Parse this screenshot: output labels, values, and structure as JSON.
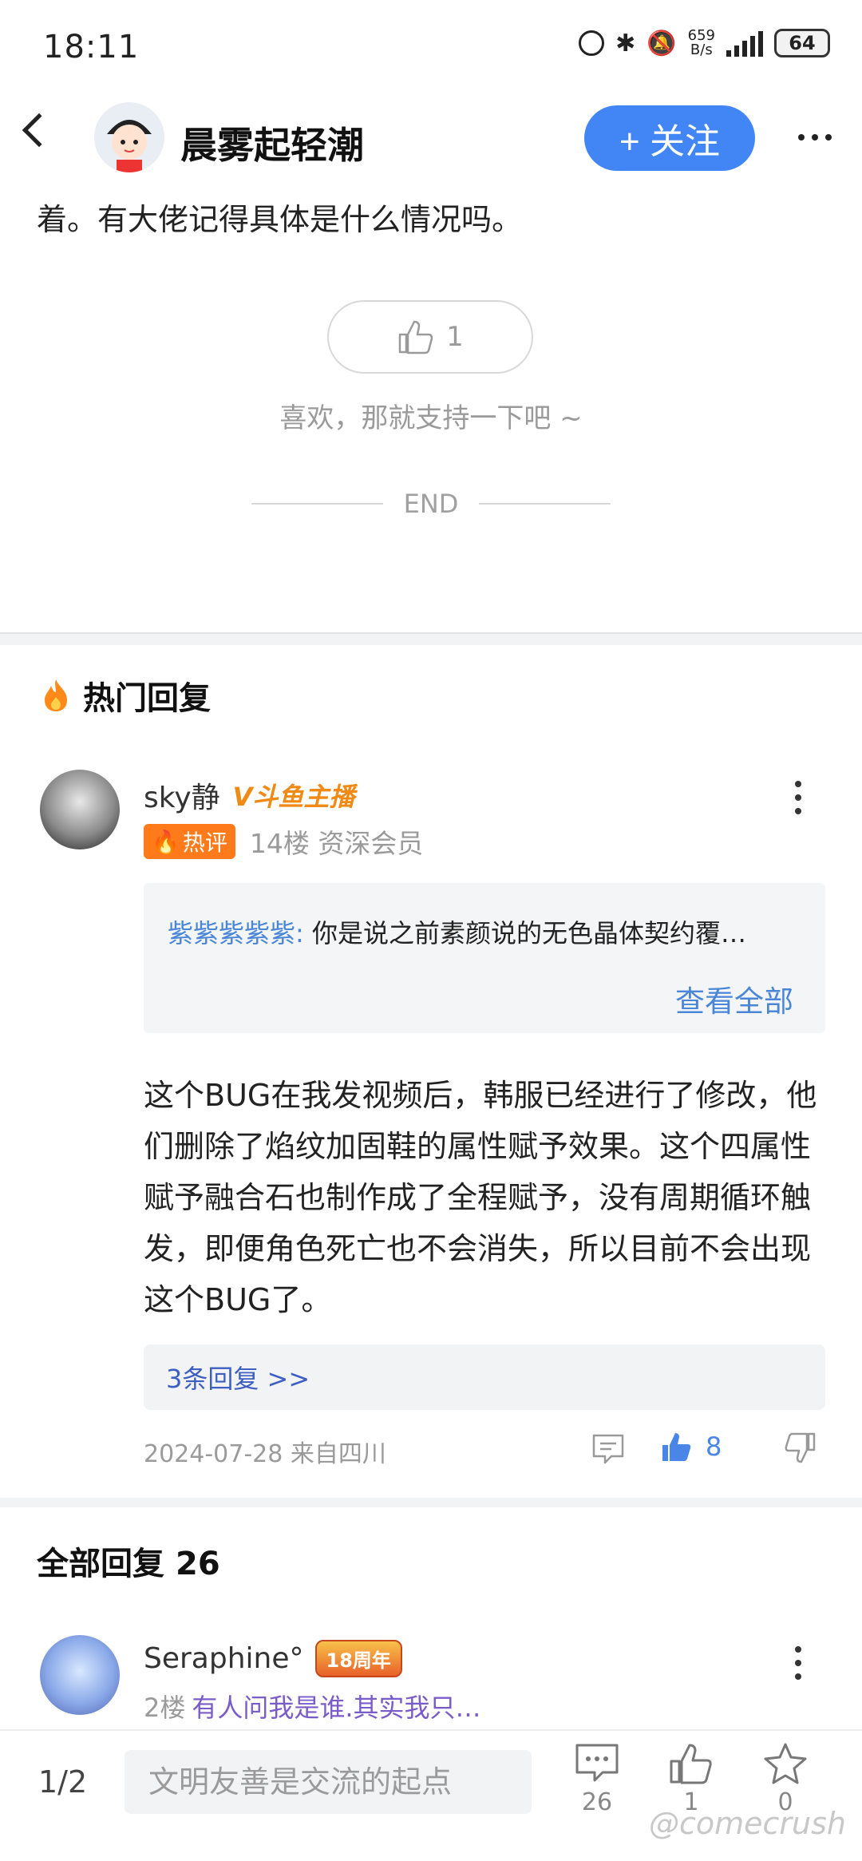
{
  "status_bar": {
    "time": "18:11",
    "net_speed_top": "659",
    "net_speed_bottom": "B/s",
    "battery": "64"
  },
  "header": {
    "author": "晨雾起轻潮",
    "follow_label": "+ 关注"
  },
  "post": {
    "tail_text": "着。有大佬记得具体是什么情况吗。",
    "like_count": "1",
    "like_hint": "喜欢，那就支持一下吧 ~",
    "end_label": "END"
  },
  "hot_replies": {
    "title": "热门回复",
    "comment": {
      "username": "sky静",
      "badge": "V斗鱼主播",
      "hot_tag": "热评",
      "floor_info": "14楼 资深会员",
      "quote_name": "紫紫紫紫紫:",
      "quote_text": "你是说之前素颜说的无色晶体契约覆…",
      "see_all": "查看全部",
      "body": "这个BUG在我发视频后，韩服已经进行了修改，他们删除了焰纹加固鞋的属性赋予效果。这个四属性赋予融合石也制作成了全程赋予，没有周期循环触发，即便角色死亡也不会消失，所以目前不会出现这个BUG了。",
      "reply_link": "3条回复 >>",
      "date_location": "2024-07-28 来自四川",
      "like_count": "8"
    }
  },
  "all_replies": {
    "title": "全部回复",
    "count": "26",
    "first": {
      "username": "Seraphine°",
      "badge": "18周年",
      "floor": "2楼",
      "preview": "有人问我是谁.其实我只…"
    }
  },
  "bottom_bar": {
    "page_indicator": "1/2",
    "input_placeholder": "文明友善是交流的起点",
    "comment_count": "26",
    "like_count": "1",
    "star_count": "0",
    "watermark": "@comecrush"
  },
  "colors": {
    "accent": "#4286f5",
    "link": "#4a86d8",
    "hot_tag": "#ff7a1a"
  }
}
